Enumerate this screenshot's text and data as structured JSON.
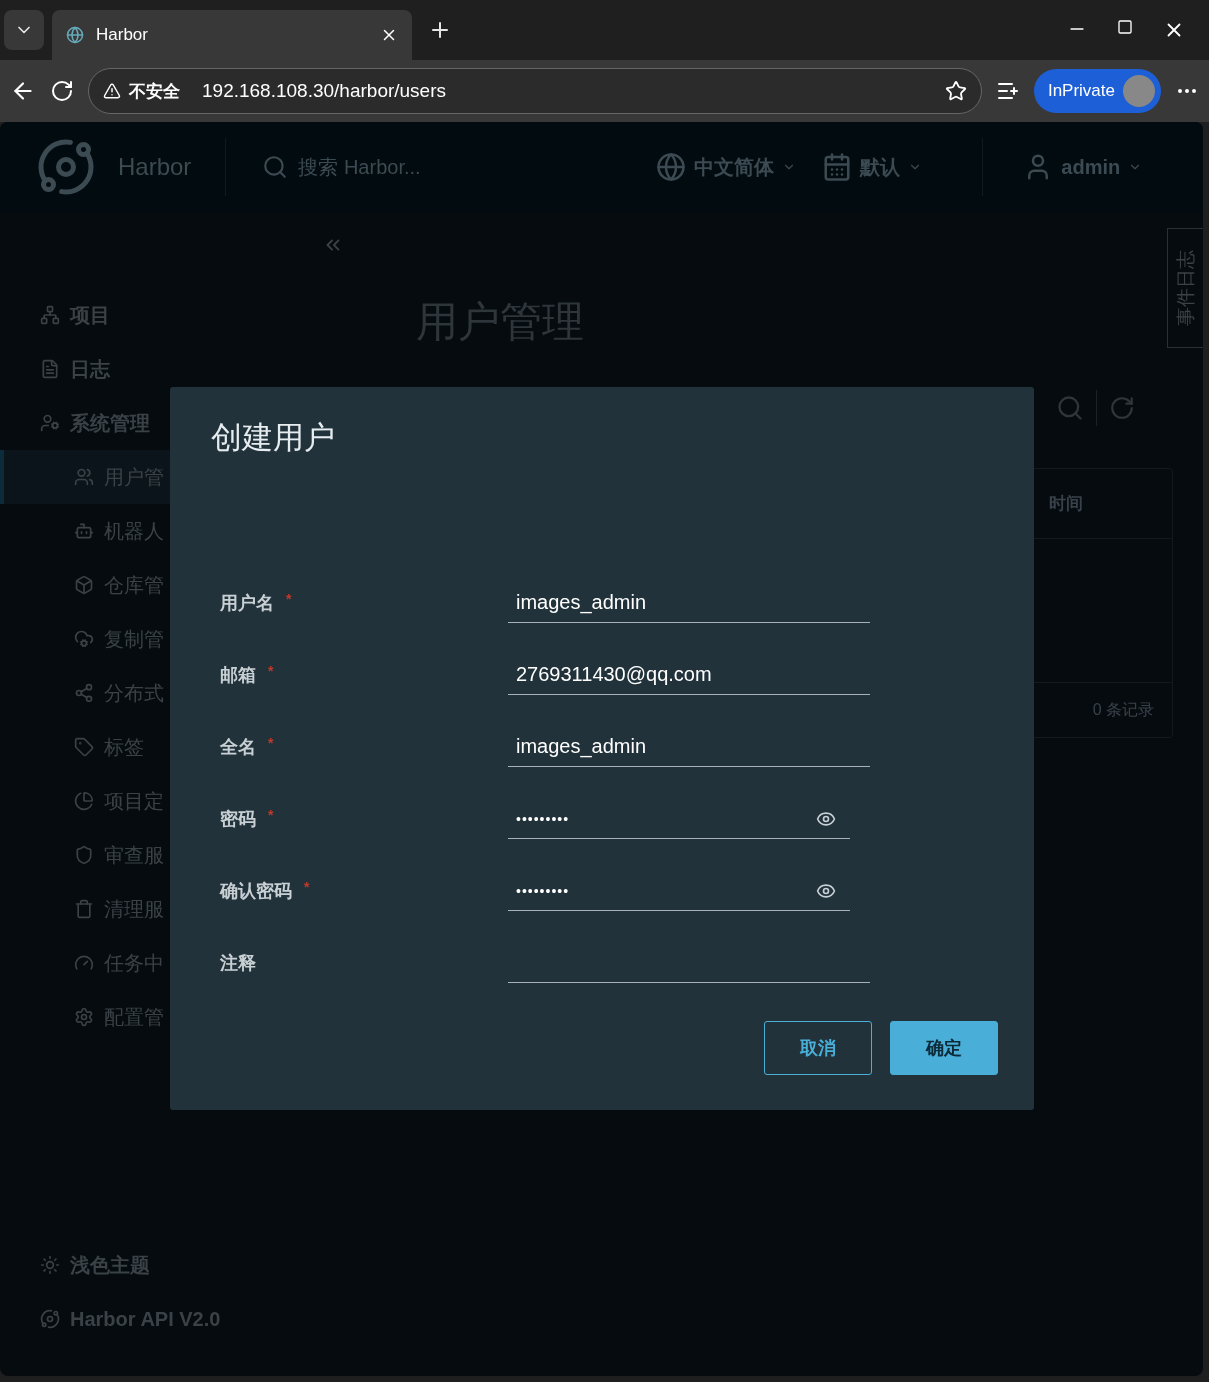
{
  "browser": {
    "tab_title": "Harbor",
    "security": "不安全",
    "url": "192.168.108.30/harbor/users",
    "profile": "InPrivate"
  },
  "header": {
    "brand": "Harbor",
    "search": {
      "placeholder": "搜索 Harbor..."
    },
    "language": "中文简体",
    "theme": "默认",
    "user": "admin"
  },
  "sidebar": {
    "items": [
      {
        "label": "项目"
      },
      {
        "label": "日志"
      },
      {
        "label": "系统管理",
        "children": [
          {
            "label": "用户管",
            "selected": true
          },
          {
            "label": "机器人",
            "selected": false
          },
          {
            "label": "仓库管",
            "selected": false
          },
          {
            "label": "复制管",
            "selected": false
          },
          {
            "label": "分布式",
            "selected": false
          },
          {
            "label": "标签",
            "selected": false
          },
          {
            "label": "项目定",
            "selected": false
          },
          {
            "label": "审查服",
            "selected": false
          },
          {
            "label": "清理服",
            "selected": false
          },
          {
            "label": "任务中",
            "selected": false
          },
          {
            "label": "配置管",
            "selected": false
          }
        ]
      }
    ],
    "footer": [
      "浅色主题",
      "Harbor API V2.0"
    ]
  },
  "page": {
    "title": "用户管理",
    "event_log": "事件日志",
    "table": {
      "column": "时间",
      "record_count": "0 条记录"
    }
  },
  "dialog": {
    "title": "创建用户",
    "fields": [
      {
        "label": "用户名",
        "required_mark": "*",
        "kind": "text",
        "value": "images_admin"
      },
      {
        "label": "邮箱",
        "required_mark": "*",
        "kind": "text",
        "value": "2769311430@qq.com"
      },
      {
        "label": "全名",
        "required_mark": "*",
        "kind": "text",
        "value": "images_admin"
      },
      {
        "label": "密码",
        "required_mark": "*",
        "kind": "password",
        "value": "•••••••••"
      },
      {
        "label": "确认密码",
        "required_mark": "*",
        "kind": "password",
        "value": "•••••••••"
      },
      {
        "label": "注释",
        "kind": "text"
      }
    ],
    "buttons": [
      {
        "label": "取消",
        "kind": "secondary"
      },
      {
        "label": "确定",
        "kind": "primary"
      }
    ]
  }
}
